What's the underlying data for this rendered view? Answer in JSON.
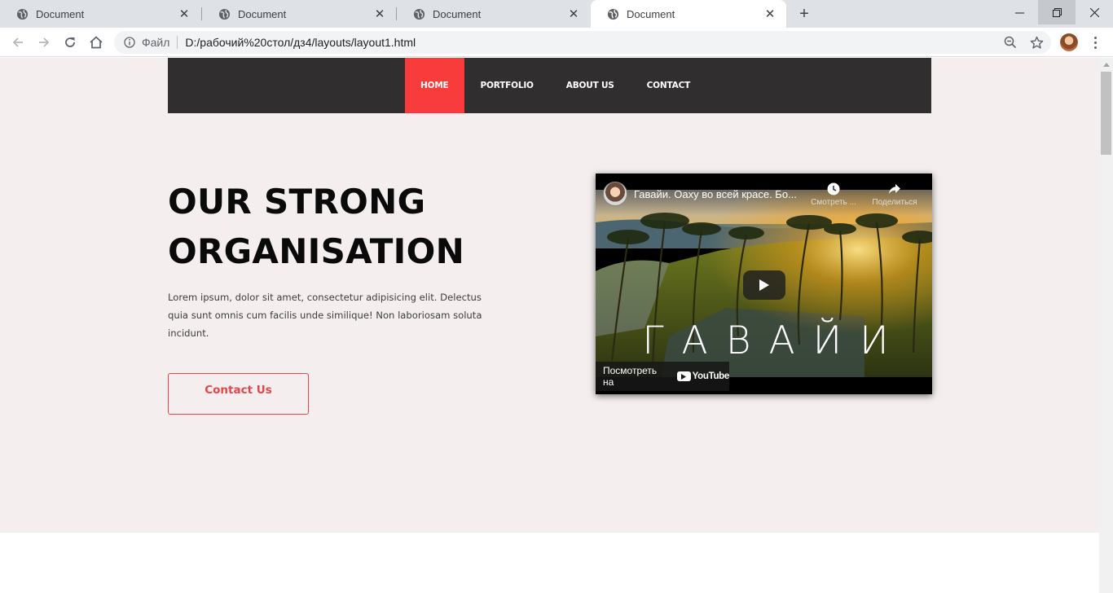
{
  "browser": {
    "tabs": [
      {
        "title": "Document",
        "active": false
      },
      {
        "title": "Document",
        "active": false
      },
      {
        "title": "Document",
        "active": false
      },
      {
        "title": "Document",
        "active": true
      }
    ],
    "address": {
      "scheme_label": "Файл",
      "url": "D:/рабочий%20стол/дз4/layouts/layout1.html"
    }
  },
  "site": {
    "nav": [
      {
        "label": "HOME",
        "active": true
      },
      {
        "label": "PORTFOLIO",
        "active": false
      },
      {
        "label": "ABOUT US",
        "active": false
      },
      {
        "label": "CONTACT",
        "active": false
      }
    ],
    "hero": {
      "title_line1": "OUR STRONG",
      "title_line2": "ORGANISATION",
      "text": "Lorem ipsum, dolor sit amet, consectetur adipisicing elit. Delectus quia sunt omnis cum facilis unde similique! Non laboriosam soluta incidunt.",
      "button_label": "Contact Us"
    },
    "video": {
      "title": "Гавайи. Оаху во всей красе. Бо...",
      "watch_later_label": "Смотреть ...",
      "share_label": "Поделиться",
      "overlay_word": "ГАВАЙИ",
      "watch_on_label": "Посмотреть на",
      "youtube_label": "YouTube"
    }
  },
  "colors": {
    "nav_bg": "#302e2f",
    "nav_active": "#f83b3b",
    "hero_bg": "#f4efee",
    "accent": "#e2464a"
  }
}
